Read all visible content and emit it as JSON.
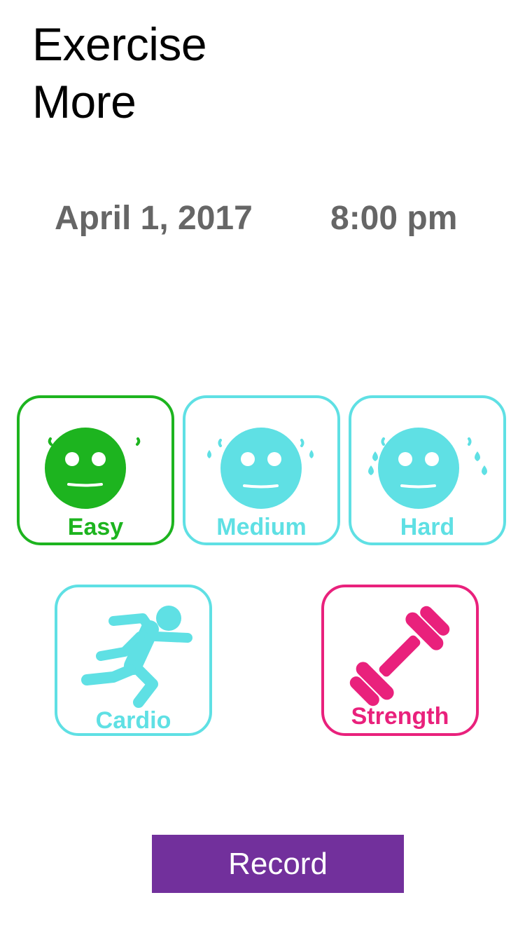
{
  "title": {
    "line1": "Exercise",
    "line2": "More"
  },
  "date": "April 1, 2017",
  "time": "8:00 pm",
  "difficulty": [
    {
      "label": "Easy",
      "icon": "neutral-face-icon",
      "color": "#1db41f",
      "selected": true
    },
    {
      "label": "Medium",
      "icon": "sweating-face-icon",
      "color": "#5fe0e4",
      "selected": false
    },
    {
      "label": "Hard",
      "icon": "heavy-sweating-face-icon",
      "color": "#5fe0e4",
      "selected": false
    }
  ],
  "exercise_type": [
    {
      "label": "Cardio",
      "icon": "running-person-icon",
      "color": "#5fe0e4",
      "selected": false
    },
    {
      "label": "Strength",
      "icon": "dumbbell-icon",
      "color": "#e9217c",
      "selected": true
    }
  ],
  "record_button": {
    "label": "Record",
    "color": "#72309c"
  },
  "colors": {
    "easy_green": "#1db41f",
    "cyan": "#5fe0e4",
    "pink": "#e9217c",
    "purple": "#72309c",
    "gray_text": "#666666"
  }
}
